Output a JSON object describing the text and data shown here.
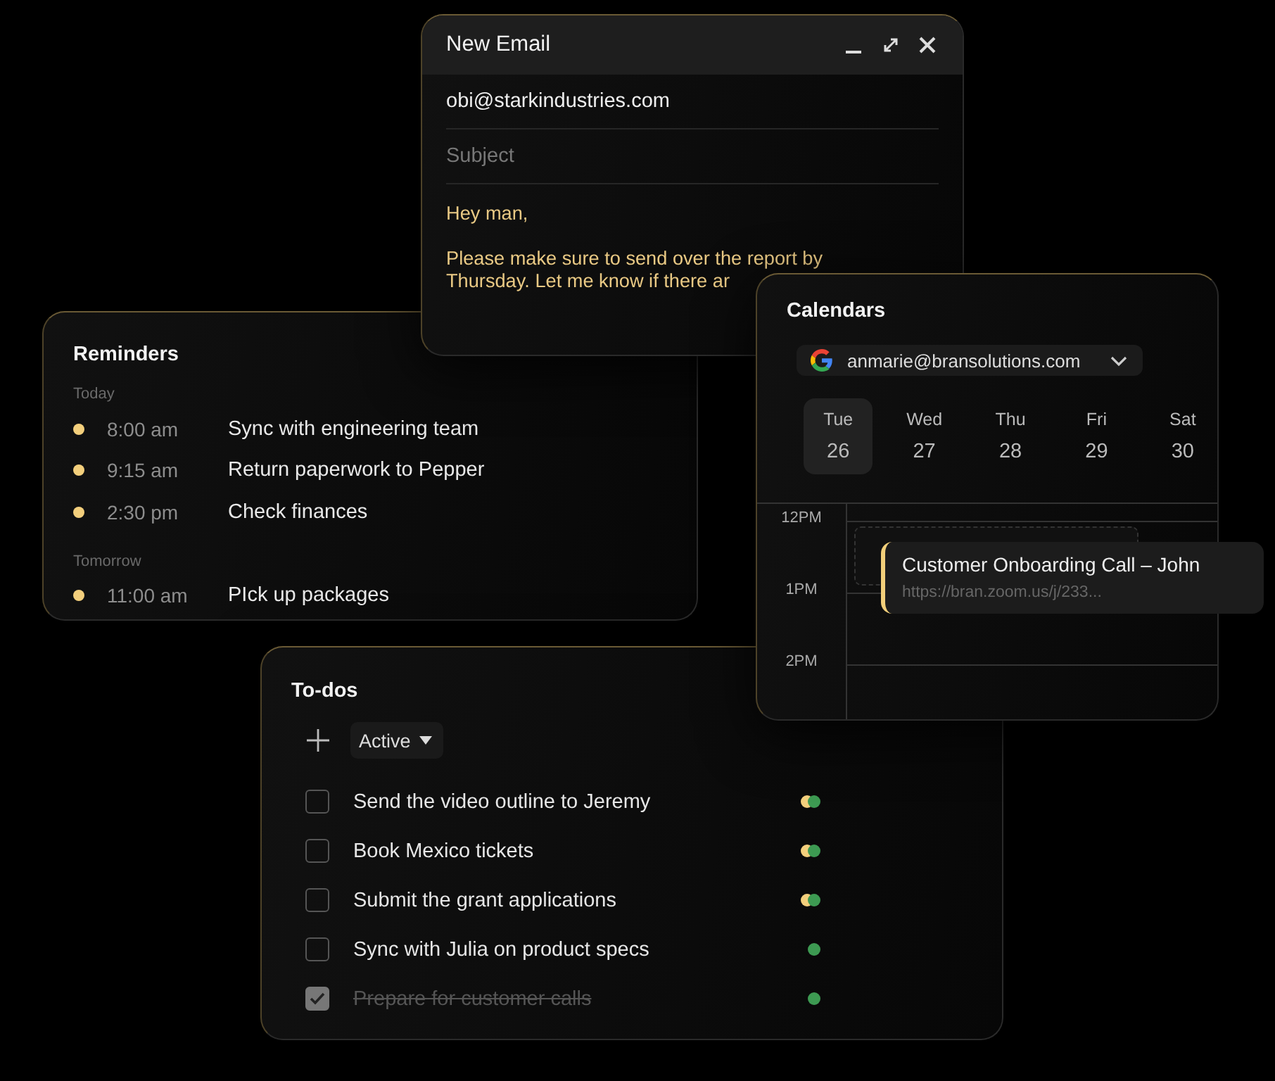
{
  "email": {
    "title": "New Email",
    "to": "obi@starkindustries.com",
    "subject": {
      "placeholder": "Subject"
    },
    "body_lines": [
      "Hey man,",
      "Please make sure to send over the report by",
      "Thursday. Let me know if there ar"
    ]
  },
  "reminders": {
    "title": "Reminders",
    "groups": [
      {
        "label": "Today",
        "items": [
          {
            "time": "8:00 am",
            "text": "Sync with engineering team"
          },
          {
            "time": "9:15 am",
            "text": "Return paperwork to Pepper"
          },
          {
            "time": "2:30 pm",
            "text": "Check finances"
          }
        ]
      },
      {
        "label": "Tomorrow",
        "items": [
          {
            "time": "11:00 am",
            "text": "PIck up packages"
          }
        ]
      }
    ]
  },
  "calendar": {
    "title": "Calendars",
    "account": "anmarie@bransolutions.com",
    "days": [
      {
        "name": "Tue",
        "date": "26",
        "selected": true
      },
      {
        "name": "Wed",
        "date": "27",
        "selected": false
      },
      {
        "name": "Thu",
        "date": "28",
        "selected": false
      },
      {
        "name": "Fri",
        "date": "29",
        "selected": false
      },
      {
        "name": "Sat",
        "date": "30",
        "selected": false
      }
    ],
    "hours": [
      "12PM",
      "1PM",
      "2PM"
    ],
    "event": {
      "title": "Customer Onboarding Call – John",
      "link": "https://bran.zoom.us/j/233..."
    }
  },
  "todos": {
    "title": "To-dos",
    "filter": "Active",
    "items": [
      {
        "text": "Send the video outline to Jeremy",
        "checked": false,
        "dots": [
          {
            "color": "#f3cf7c"
          },
          {
            "color": "#3d9a52"
          }
        ]
      },
      {
        "text": "Book Mexico tickets",
        "checked": false,
        "dots": [
          {
            "color": "#f3cf7c"
          },
          {
            "color": "#3d9a52"
          }
        ]
      },
      {
        "text": "Submit the grant applications",
        "checked": false,
        "dots": [
          {
            "color": "#f3cf7c"
          },
          {
            "color": "#3d9a52"
          }
        ]
      },
      {
        "text": "Sync with Julia on product specs",
        "checked": false,
        "dots": [
          {
            "color": "#3d9a52"
          }
        ]
      },
      {
        "text": "Prepare for customer calls",
        "checked": true,
        "dots": [
          {
            "color": "#3d9a52"
          }
        ]
      }
    ]
  }
}
